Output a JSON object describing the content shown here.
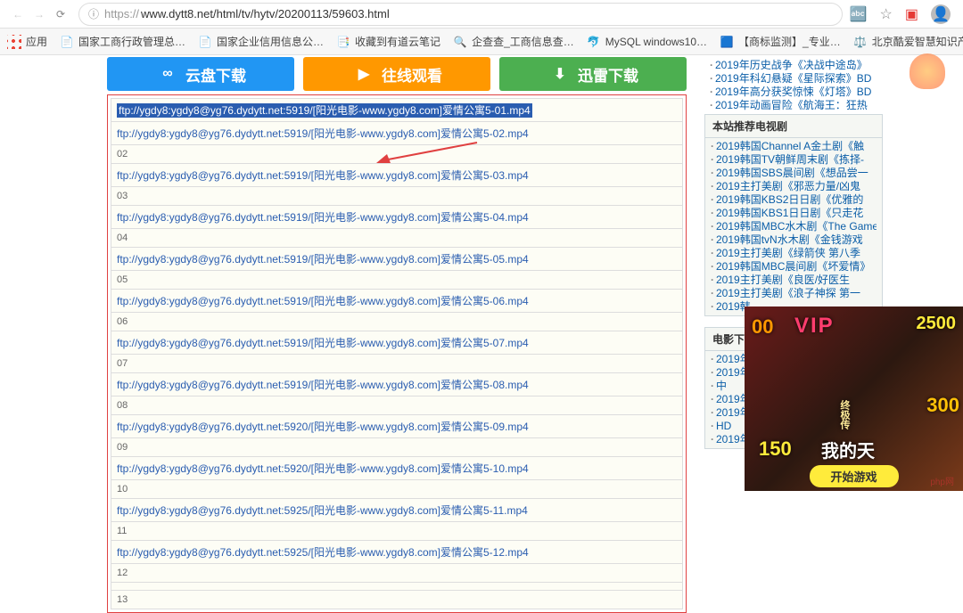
{
  "browser": {
    "url_protocol": "https://",
    "url": "www.dytt8.net/html/tv/hytv/20200113/59603.html",
    "info_icon": "ⓘ"
  },
  "bookmarks": [
    {
      "icon": "apps",
      "label": "应用"
    },
    {
      "icon": "📄",
      "label": "国家工商行政管理总…"
    },
    {
      "icon": "📄",
      "label": "国家企业信用信息公…"
    },
    {
      "icon": "📑",
      "label": "收藏到有道云笔记"
    },
    {
      "icon": "🔍",
      "label": "企查查_工商信息查…"
    },
    {
      "icon": "🐬",
      "label": "MySQL windows10…"
    },
    {
      "icon": "🟦",
      "label": "【商标监测】_专业…"
    },
    {
      "icon": "⚖️",
      "label": "北京酷爱智慧知识产…"
    }
  ],
  "buttons": {
    "b1": "云盘下载",
    "b2": "往线观看",
    "b3": "迅雷下载"
  },
  "downloads": [
    {
      "n": "",
      "url": "ftp://ygdy8:ygdy8@yg76.dydytt.net:5919/[阳光电影-www.ygdy8.com]爱情公寓5-01.mp4",
      "selected": true
    },
    {
      "n": "02",
      "url": "ftp://ygdy8:ygdy8@yg76.dydytt.net:5919/[阳光电影-www.ygdy8.com]爱情公寓5-02.mp4"
    },
    {
      "n": "03",
      "url": "ftp://ygdy8:ygdy8@yg76.dydytt.net:5919/[阳光电影-www.ygdy8.com]爱情公寓5-03.mp4"
    },
    {
      "n": "04",
      "url": "ftp://ygdy8:ygdy8@yg76.dydytt.net:5919/[阳光电影-www.ygdy8.com]爱情公寓5-04.mp4"
    },
    {
      "n": "05",
      "url": "ftp://ygdy8:ygdy8@yg76.dydytt.net:5919/[阳光电影-www.ygdy8.com]爱情公寓5-05.mp4"
    },
    {
      "n": "06",
      "url": "ftp://ygdy8:ygdy8@yg76.dydytt.net:5919/[阳光电影-www.ygdy8.com]爱情公寓5-06.mp4"
    },
    {
      "n": "07",
      "url": "ftp://ygdy8:ygdy8@yg76.dydytt.net:5919/[阳光电影-www.ygdy8.com]爱情公寓5-07.mp4"
    },
    {
      "n": "08",
      "url": "ftp://ygdy8:ygdy8@yg76.dydytt.net:5919/[阳光电影-www.ygdy8.com]爱情公寓5-08.mp4"
    },
    {
      "n": "09",
      "url": "ftp://ygdy8:ygdy8@yg76.dydytt.net:5920/[阳光电影-www.ygdy8.com]爱情公寓5-09.mp4"
    },
    {
      "n": "10",
      "url": "ftp://ygdy8:ygdy8@yg76.dydytt.net:5920/[阳光电影-www.ygdy8.com]爱情公寓5-10.mp4"
    },
    {
      "n": "11",
      "url": "ftp://ygdy8:ygdy8@yg76.dydytt.net:5925/[阳光电影-www.ygdy8.com]爱情公寓5-11.mp4"
    },
    {
      "n": "12",
      "url": "ftp://ygdy8:ygdy8@yg76.dydytt.net:5925/[阳光电影-www.ygdy8.com]爱情公寓5-12.mp4"
    },
    {
      "n": "13",
      "url": ""
    }
  ],
  "sidebar_top": [
    "2019年历史战争《决战中途岛》",
    "2019年科幻悬疑《星际探索》BD",
    "2019年高分获奖惊悚《灯塔》BD",
    "2019年动画冒险《航海王：狂热"
  ],
  "sidebar_tv_title": "本站推荐电视剧",
  "sidebar_tv": [
    "2019韩国Channel A金土剧《触",
    "2019韩国TV朝鲜周末剧《拣择-",
    "2019韩国SBS晨间剧《想品尝一",
    "2019主打美剧《邪恶力量/凶鬼",
    "2019韩国KBS2日日剧《优雅的",
    "2019韩国KBS1日日剧《只走花",
    "2019韩国MBC水木剧《The Game",
    "2019韩国tvN水木剧《金钱游戏",
    "2019主打美剧《绿箭侠 第八季",
    "2019韩国MBC晨间剧《坏爱情》",
    "2019主打美剧《良医/好医生",
    "2019主打美剧《浪子神探 第一",
    "2019韩"
  ],
  "sidebar_movie_title": "电影下载",
  "sidebar_movie": [
    "2019年",
    "2019年",
    "中",
    "2019年",
    "2019年",
    "HD",
    "2019年"
  ],
  "ad": {
    "t1": "00",
    "t2": "VIP",
    "t3": "2500",
    "t4": "150",
    "t5": "300",
    "t6": "终极传",
    "t7": "我的天",
    "play": "开始游戏"
  },
  "wm": "php网"
}
